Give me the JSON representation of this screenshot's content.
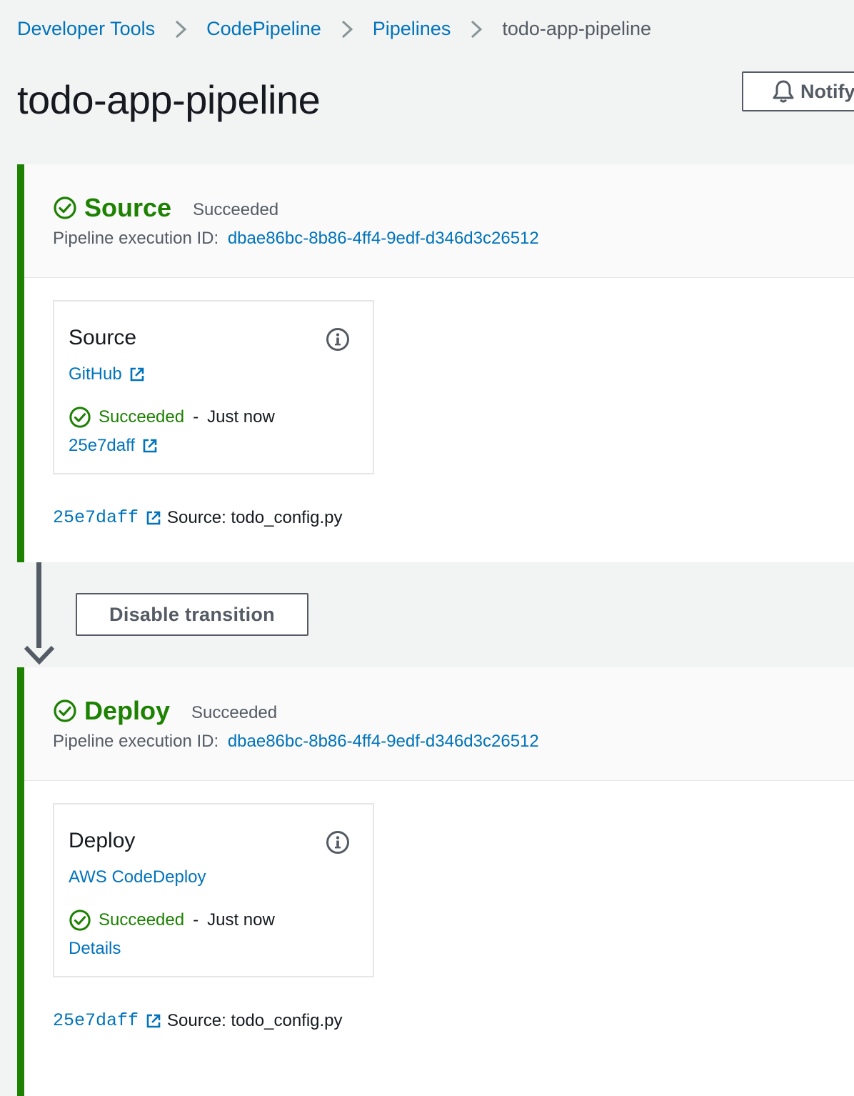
{
  "breadcrumb": {
    "items": [
      "Developer Tools",
      "CodePipeline",
      "Pipelines"
    ],
    "current": "todo-app-pipeline"
  },
  "page": {
    "title": "todo-app-pipeline",
    "notify_label": "Notify"
  },
  "colors": {
    "success": "#1d8102",
    "link": "#0073bb",
    "muted": "#545b64"
  },
  "icons": {
    "breadcrumb_separator": "chevron-right-icon",
    "notify": "bell-icon",
    "status": "check-circle-icon",
    "info": "info-icon",
    "external": "external-link-icon",
    "transition": "arrow-down-icon"
  },
  "stages": [
    {
      "name": "Source",
      "status": "Succeeded",
      "exec_label": "Pipeline execution ID:",
      "exec_id": "dbae86bc-8b86-4ff4-9edf-d346d3c26512",
      "action": {
        "name": "Source",
        "provider": "GitHub",
        "status": "Succeeded",
        "separator": "-",
        "time": "Just now",
        "link": "25e7daff"
      },
      "revision": {
        "id": "25e7daff",
        "summary": "Source: todo_config.py"
      }
    },
    {
      "name": "Deploy",
      "status": "Succeeded",
      "exec_label": "Pipeline execution ID:",
      "exec_id": "dbae86bc-8b86-4ff4-9edf-d346d3c26512",
      "action": {
        "name": "Deploy",
        "provider": "AWS CodeDeploy",
        "status": "Succeeded",
        "separator": "-",
        "time": "Just now",
        "link": "Details"
      },
      "revision": {
        "id": "25e7daff",
        "summary": "Source: todo_config.py"
      }
    }
  ],
  "transition": {
    "button_label": "Disable transition"
  }
}
